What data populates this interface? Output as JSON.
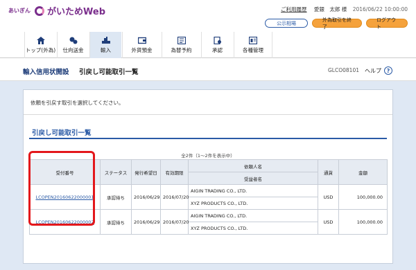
{
  "header": {
    "bank_name": "あいぎん",
    "app_name": "がいためWeb",
    "history_link": "ご利用履歴",
    "user": "愛銀　太郎 様",
    "datetime": "2016/06/22 10:00:00",
    "buttons": {
      "market": "公示相場",
      "end_trade": "外為取引を終了",
      "logout": "ログアウト"
    }
  },
  "nav": {
    "items": [
      {
        "label": "トップ(外為)",
        "icon": "home-icon"
      },
      {
        "label": "仕向送金",
        "icon": "remittance-icon"
      },
      {
        "label": "輸入",
        "icon": "import-icon"
      },
      {
        "label": "外貨預金",
        "icon": "deposit-icon"
      },
      {
        "label": "為替予約",
        "icon": "forward-contract-icon"
      },
      {
        "label": "承認",
        "icon": "approval-icon"
      },
      {
        "label": "各種管理",
        "icon": "management-icon"
      }
    ]
  },
  "page": {
    "section": "輸入信用状開設",
    "title": "引戻し可能取引一覧",
    "code": "GLCO08101",
    "help": "ヘルプ",
    "help_icon": "?",
    "instruction": "依頼を引戻す取引を選択してください。",
    "list_title": "引戻し可能取引一覧",
    "count_text": "全2件（1～2件を表示中）"
  },
  "table": {
    "headers": {
      "receipt_no": "受付番号",
      "status": "ステータス",
      "issue_date": "発行希望日",
      "expiry": "有効期限",
      "applicant": "依頼人名",
      "beneficiary": "受益者名",
      "currency": "通貨",
      "amount": "金額"
    },
    "rows": [
      {
        "receipt_no": "LCOPEN20160622000001",
        "status": "承認待ち",
        "issue_date": "2016/06/29",
        "expiry": "2016/07/20",
        "applicant": "AIGIN TRADING CO., LTD.",
        "beneficiary": "XYZ PRODUCTS CO., LTD.",
        "currency": "USD",
        "amount": "100,000.00"
      },
      {
        "receipt_no": "LCOPEN20160622000002",
        "status": "承認待ち",
        "issue_date": "2016/06/29",
        "expiry": "2016/07/20",
        "applicant": "AIGIN TRADING CO., LTD.",
        "beneficiary": "XYZ PRODUCTS CO., LTD.",
        "currency": "USD",
        "amount": "100,000.00"
      }
    ]
  },
  "colors": {
    "brand": "#7a2e8c",
    "accent_blue": "#2a5aa6",
    "orange_button": "#f5a23c",
    "highlight": "#e3171b",
    "content_bg": "#dfe8f4"
  }
}
